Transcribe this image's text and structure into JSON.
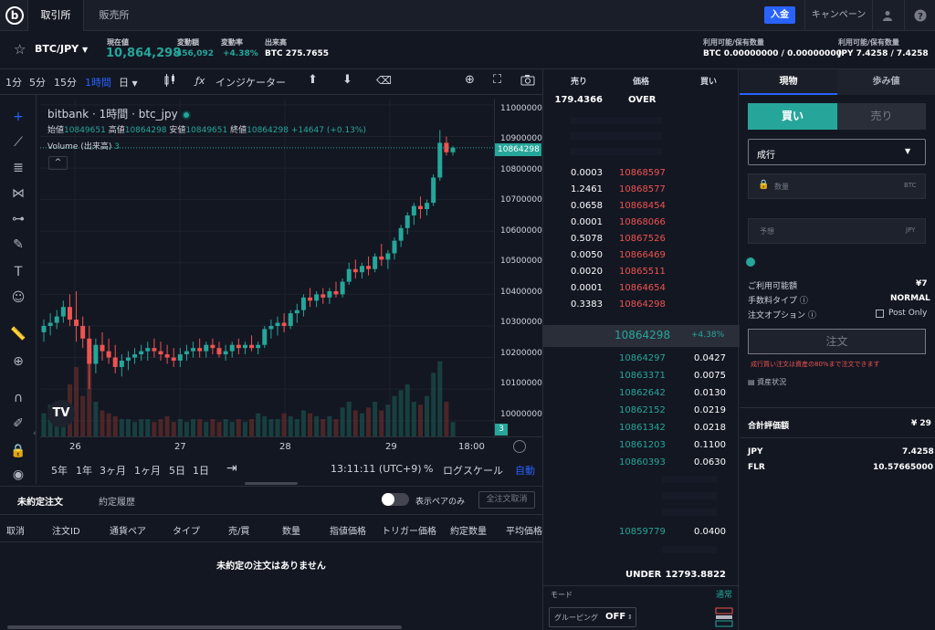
{
  "topbar": {
    "logo": "b",
    "tabs": [
      "取引所",
      "販売所"
    ],
    "deposit_label": "入金",
    "campaign_label": "キャンペーン",
    "user_icon": "user-icon",
    "help_icon": "help-icon"
  },
  "ticker": {
    "pair": "BTC/JPY",
    "current_label": "現在値",
    "current_value": "10,864,298",
    "change_label": "変動額",
    "change_value": "456,092",
    "rate_label": "変動率",
    "rate_value": "+4.38%",
    "volume_label": "出来高",
    "volume_value": "BTC 275.7655",
    "btc_avail_label": "利用可能/保有数量",
    "btc_avail_value": "BTC 0.00000000 / 0.00000000",
    "jpy_avail_label": "利用可能/保有数量",
    "jpy_avail_value": "JPY 7.4258 / 7.4258"
  },
  "chart_toolbar": {
    "intervals": [
      "1分",
      "5分",
      "15分",
      "1時間",
      "日"
    ],
    "active_interval": "1時間",
    "indicator_label": "インジケーター"
  },
  "chart": {
    "legend_title": "bitbank · 1時間 · btc_jpy",
    "ohlc_open_label": "始値",
    "ohlc_open": "10849651",
    "ohlc_high_label": "高値",
    "ohlc_high": "10864298",
    "ohlc_low_label": "安値",
    "ohlc_low": "10849651",
    "ohlc_close_label": "終値",
    "ohlc_close": "10864298",
    "ohlc_change": "+14647 (+0.13%)",
    "volume_label": "Volume (出来高)",
    "volume_value": "3",
    "price_ticks": [
      "11000000",
      "10900000",
      "10800000",
      "10700000",
      "10600000",
      "10500000",
      "10400000",
      "10300000",
      "10200000",
      "10100000",
      "10000000"
    ],
    "last_price_tag": "10864298",
    "volume_tag": "3",
    "time_ticks": [
      "26",
      "27",
      "28",
      "29",
      "18:00"
    ],
    "ranges": [
      "5年",
      "1年",
      "3ヶ月",
      "1ヶ月",
      "5日",
      "1日"
    ],
    "clock": "13:11:11 (UTC+9)",
    "percent_label": "%",
    "log_label": "ログスケール",
    "auto_label": "自動",
    "colors": {
      "up": "#26a69a",
      "down": "#ef5350"
    }
  },
  "chart_data": {
    "type": "candlestick",
    "ylim": [
      9950000,
      11020000
    ],
    "candles": [
      [
        10280000,
        10320000,
        10250000,
        10300000
      ],
      [
        10300000,
        10340000,
        10270000,
        10310000
      ],
      [
        10310000,
        10350000,
        10290000,
        10330000
      ],
      [
        10330000,
        10380000,
        10310000,
        10360000
      ],
      [
        10360000,
        10400000,
        10300000,
        10320000
      ],
      [
        10320000,
        10410000,
        10250000,
        10300000
      ],
      [
        10300000,
        10330000,
        10230000,
        10260000
      ],
      [
        10260000,
        10300000,
        10100000,
        10180000
      ],
      [
        10180000,
        10260000,
        10150000,
        10240000
      ],
      [
        10240000,
        10280000,
        10190000,
        10220000
      ],
      [
        10220000,
        10260000,
        10180000,
        10200000
      ],
      [
        10200000,
        10240000,
        10150000,
        10170000
      ],
      [
        10170000,
        10210000,
        10140000,
        10190000
      ],
      [
        10190000,
        10220000,
        10160000,
        10200000
      ],
      [
        10200000,
        10230000,
        10180000,
        10210000
      ],
      [
        10210000,
        10240000,
        10190000,
        10220000
      ],
      [
        10220000,
        10250000,
        10190000,
        10230000
      ],
      [
        10230000,
        10260000,
        10200000,
        10220000
      ],
      [
        10220000,
        10250000,
        10190000,
        10210000
      ],
      [
        10210000,
        10240000,
        10180000,
        10200000
      ],
      [
        10200000,
        10230000,
        10170000,
        10190000
      ],
      [
        10190000,
        10230000,
        10170000,
        10210000
      ],
      [
        10210000,
        10240000,
        10190000,
        10220000
      ],
      [
        10220000,
        10250000,
        10200000,
        10230000
      ],
      [
        10230000,
        10260000,
        10200000,
        10220000
      ],
      [
        10220000,
        10250000,
        10200000,
        10240000
      ],
      [
        10240000,
        10260000,
        10210000,
        10230000
      ],
      [
        10230000,
        10250000,
        10200000,
        10210000
      ],
      [
        10210000,
        10240000,
        10190000,
        10220000
      ],
      [
        10220000,
        10250000,
        10200000,
        10240000
      ],
      [
        10240000,
        10260000,
        10210000,
        10230000
      ],
      [
        10230000,
        10250000,
        10210000,
        10240000
      ],
      [
        10240000,
        10270000,
        10220000,
        10230000
      ],
      [
        10230000,
        10250000,
        10210000,
        10240000
      ],
      [
        10240000,
        10300000,
        10230000,
        10290000
      ],
      [
        10290000,
        10320000,
        10260000,
        10300000
      ],
      [
        10300000,
        10330000,
        10270000,
        10310000
      ],
      [
        10310000,
        10340000,
        10280000,
        10300000
      ],
      [
        10300000,
        10350000,
        10290000,
        10340000
      ],
      [
        10340000,
        10370000,
        10310000,
        10350000
      ],
      [
        10350000,
        10400000,
        10330000,
        10390000
      ],
      [
        10390000,
        10420000,
        10360000,
        10380000
      ],
      [
        10380000,
        10410000,
        10360000,
        10400000
      ],
      [
        10400000,
        10420000,
        10370000,
        10390000
      ],
      [
        10390000,
        10420000,
        10370000,
        10410000
      ],
      [
        10410000,
        10440000,
        10390000,
        10400000
      ],
      [
        10400000,
        10450000,
        10390000,
        10440000
      ],
      [
        10440000,
        10500000,
        10430000,
        10480000
      ],
      [
        10480000,
        10510000,
        10450000,
        10470000
      ],
      [
        10470000,
        10500000,
        10450000,
        10490000
      ],
      [
        10490000,
        10520000,
        10460000,
        10480000
      ],
      [
        10480000,
        10530000,
        10470000,
        10520000
      ],
      [
        10520000,
        10560000,
        10490000,
        10510000
      ],
      [
        10510000,
        10540000,
        10480000,
        10530000
      ],
      [
        10530000,
        10580000,
        10510000,
        10570000
      ],
      [
        10570000,
        10620000,
        10550000,
        10610000
      ],
      [
        10610000,
        10660000,
        10590000,
        10650000
      ],
      [
        10650000,
        10690000,
        10620000,
        10680000
      ],
      [
        10680000,
        10710000,
        10640000,
        10670000
      ],
      [
        10670000,
        10700000,
        10650000,
        10690000
      ],
      [
        10690000,
        10780000,
        10680000,
        10770000
      ],
      [
        10770000,
        10920000,
        10760000,
        10880000
      ],
      [
        10880000,
        10900000,
        10840000,
        10850000
      ],
      [
        10850000,
        10870000,
        10840000,
        10864298
      ]
    ],
    "volumes": [
      40,
      55,
      30,
      60,
      90,
      120,
      70,
      150,
      60,
      45,
      40,
      35,
      30,
      30,
      25,
      30,
      30,
      25,
      30,
      35,
      25,
      30,
      25,
      30,
      30,
      25,
      30,
      25,
      30,
      25,
      30,
      25,
      30,
      40,
      35,
      30,
      30,
      40,
      35,
      30,
      45,
      40,
      35,
      30,
      35,
      30,
      50,
      60,
      45,
      40,
      50,
      60,
      45,
      55,
      70,
      80,
      90,
      60,
      55,
      70,
      110,
      130,
      60,
      25
    ]
  },
  "orders": {
    "tabs": [
      "未約定注文",
      "約定履歴"
    ],
    "toggle_label": "表示ペアのみ",
    "cancel_all_label": "全注文取消",
    "columns": [
      "取消",
      "注文ID",
      "通貨ペア",
      "タイプ",
      "売/買",
      "数量",
      "指値価格",
      "トリガー価格",
      "約定数量",
      "平均価格"
    ],
    "empty_message": "未約定の注文はありません"
  },
  "book": {
    "headers": [
      "売り",
      "価格",
      "買い"
    ],
    "over_qty": "179.4366",
    "over_label": "OVER",
    "asks": [
      {
        "qty": "0.0003",
        "price": "10868597"
      },
      {
        "qty": "1.2461",
        "price": "10868577"
      },
      {
        "qty": "0.0658",
        "price": "10868454"
      },
      {
        "qty": "0.0001",
        "price": "10868066"
      },
      {
        "qty": "0.5078",
        "price": "10867526"
      },
      {
        "qty": "0.0050",
        "price": "10866469"
      },
      {
        "qty": "0.0020",
        "price": "10865511"
      },
      {
        "qty": "0.0001",
        "price": "10864654"
      },
      {
        "qty": "0.3383",
        "price": "10864298"
      }
    ],
    "last_price": "10864298",
    "last_change": "+4.38%",
    "bids": [
      {
        "price": "10864297",
        "qty": "0.0427"
      },
      {
        "price": "10863371",
        "qty": "0.0075"
      },
      {
        "price": "10862642",
        "qty": "0.0130"
      },
      {
        "price": "10862152",
        "qty": "0.0219"
      },
      {
        "price": "10861342",
        "qty": "0.0218"
      },
      {
        "price": "10861203",
        "qty": "0.1100"
      },
      {
        "price": "10860393",
        "qty": "0.0630"
      }
    ],
    "last_bid": {
      "price": "10859779",
      "qty": "0.0400"
    },
    "under_label": "UNDER",
    "under_qty": "12793.8822",
    "mode_label": "モード",
    "mode_value": "通常",
    "grouping_label": "グルーピング",
    "grouping_value": "OFF"
  },
  "trade": {
    "tabs": [
      "現物",
      "歩み値"
    ],
    "buy_label": "買い",
    "sell_label": "売り",
    "order_type": "成行",
    "qty_placeholder": "数量",
    "qty_unit": "BTC",
    "estimate_placeholder": "予想",
    "estimate_unit": "JPY",
    "avail_label": "ご利用可能額",
    "avail_value": "¥7",
    "fee_label": "手数料タイプ",
    "fee_value": "NORMAL",
    "option_label": "注文オプション",
    "post_only_label": "Post Only",
    "submit_label": "注文",
    "warning": "成行買い注文は資産の80%まで注文できます",
    "asset_label": "資産状況",
    "total_label": "合計評価額",
    "total_value": "¥ 29",
    "assets": [
      {
        "name": "JPY",
        "value": "7.4258"
      },
      {
        "name": "FLR",
        "value": "10.57665000"
      }
    ]
  }
}
